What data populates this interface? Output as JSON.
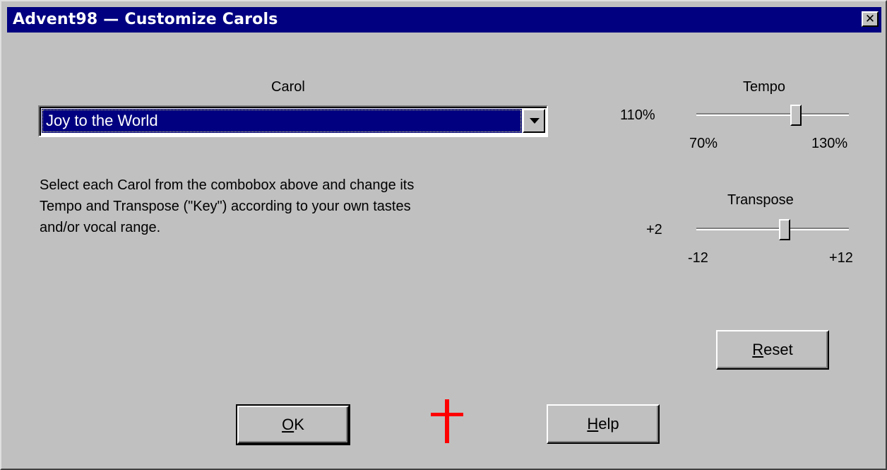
{
  "window": {
    "title": "Advent98 — Customize Carols",
    "close_label": "✕"
  },
  "carol": {
    "label": "Carol",
    "selected": "Joy to the World"
  },
  "description": {
    "lines": [
      "Select each Carol from the combobox above and change its",
      "Tempo and Transpose (\"Key\") according to your own tastes",
      "and/or vocal range."
    ]
  },
  "tempo": {
    "label": "Tempo",
    "value_text": "110%",
    "min_label": "70%",
    "max_label": "130%",
    "min": 70,
    "max": 130,
    "value": 110
  },
  "transpose": {
    "label": "Transpose",
    "value_text": "+2",
    "min_label": "-12",
    "max_label": "+12",
    "min": -12,
    "max": 12,
    "value": 2
  },
  "buttons": {
    "reset": {
      "mnemonic": "R",
      "rest": "eset"
    },
    "ok": {
      "mnemonic": "O",
      "rest": "K"
    },
    "help": {
      "mnemonic": "H",
      "rest": "elp"
    }
  },
  "cross_color": "#ff0000"
}
